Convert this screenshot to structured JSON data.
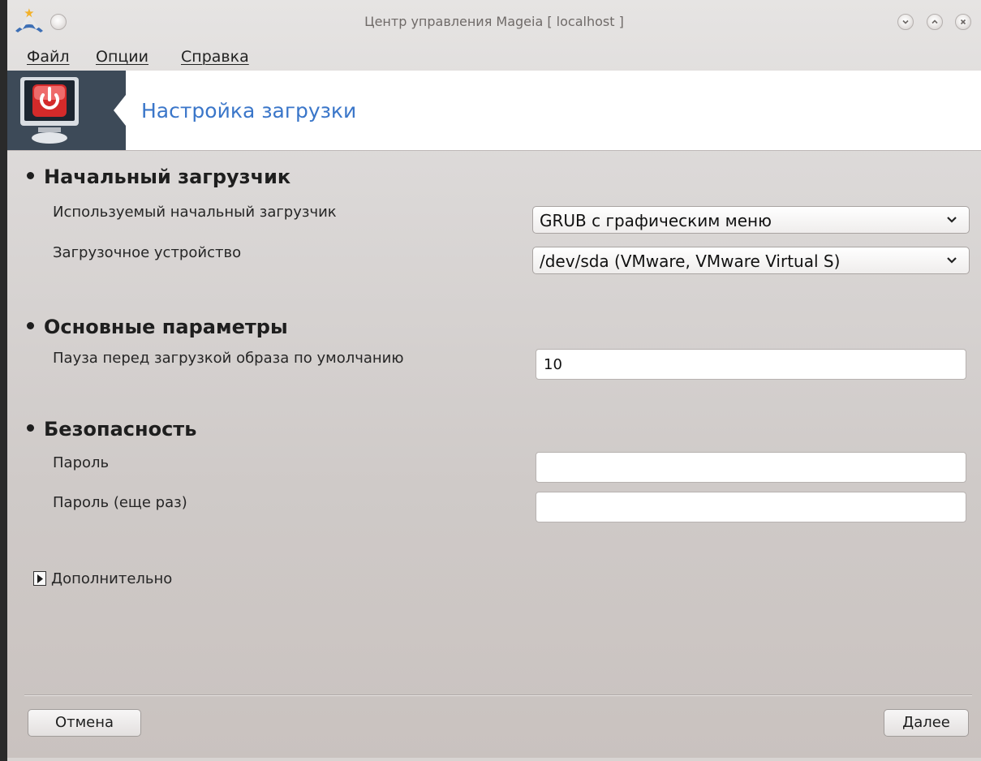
{
  "window": {
    "title": "Центр управления Mageia  [ localhost ]",
    "accent_color": "#3a76c9",
    "banner_dark_color": "#3d4a58"
  },
  "menubar": {
    "items": [
      {
        "label": "Файл"
      },
      {
        "label": "Опции"
      },
      {
        "label": "Справка"
      }
    ]
  },
  "banner": {
    "title": "Настройка загрузки",
    "icon": "power-monitor-icon"
  },
  "sections": {
    "bootloader": {
      "title": "Начальный загрузчик",
      "used_label": "Используемый начальный загрузчик",
      "used_value": "GRUB с графическим меню",
      "device_label": "Загрузочное устройство",
      "device_value": "/dev/sda (VMware, VMware Virtual S)"
    },
    "main": {
      "title": "Основные параметры",
      "delay_label": "Пауза перед загрузкой образа по умолчанию",
      "delay_value": "10"
    },
    "security": {
      "title": "Безопасность",
      "password_label": "Пароль",
      "password_value": "",
      "password_again_label": "Пароль (еще раз)",
      "password_again_value": ""
    }
  },
  "advanced": {
    "label": "Дополнительно"
  },
  "buttons": {
    "cancel": "Отмена",
    "next": "Далее"
  }
}
